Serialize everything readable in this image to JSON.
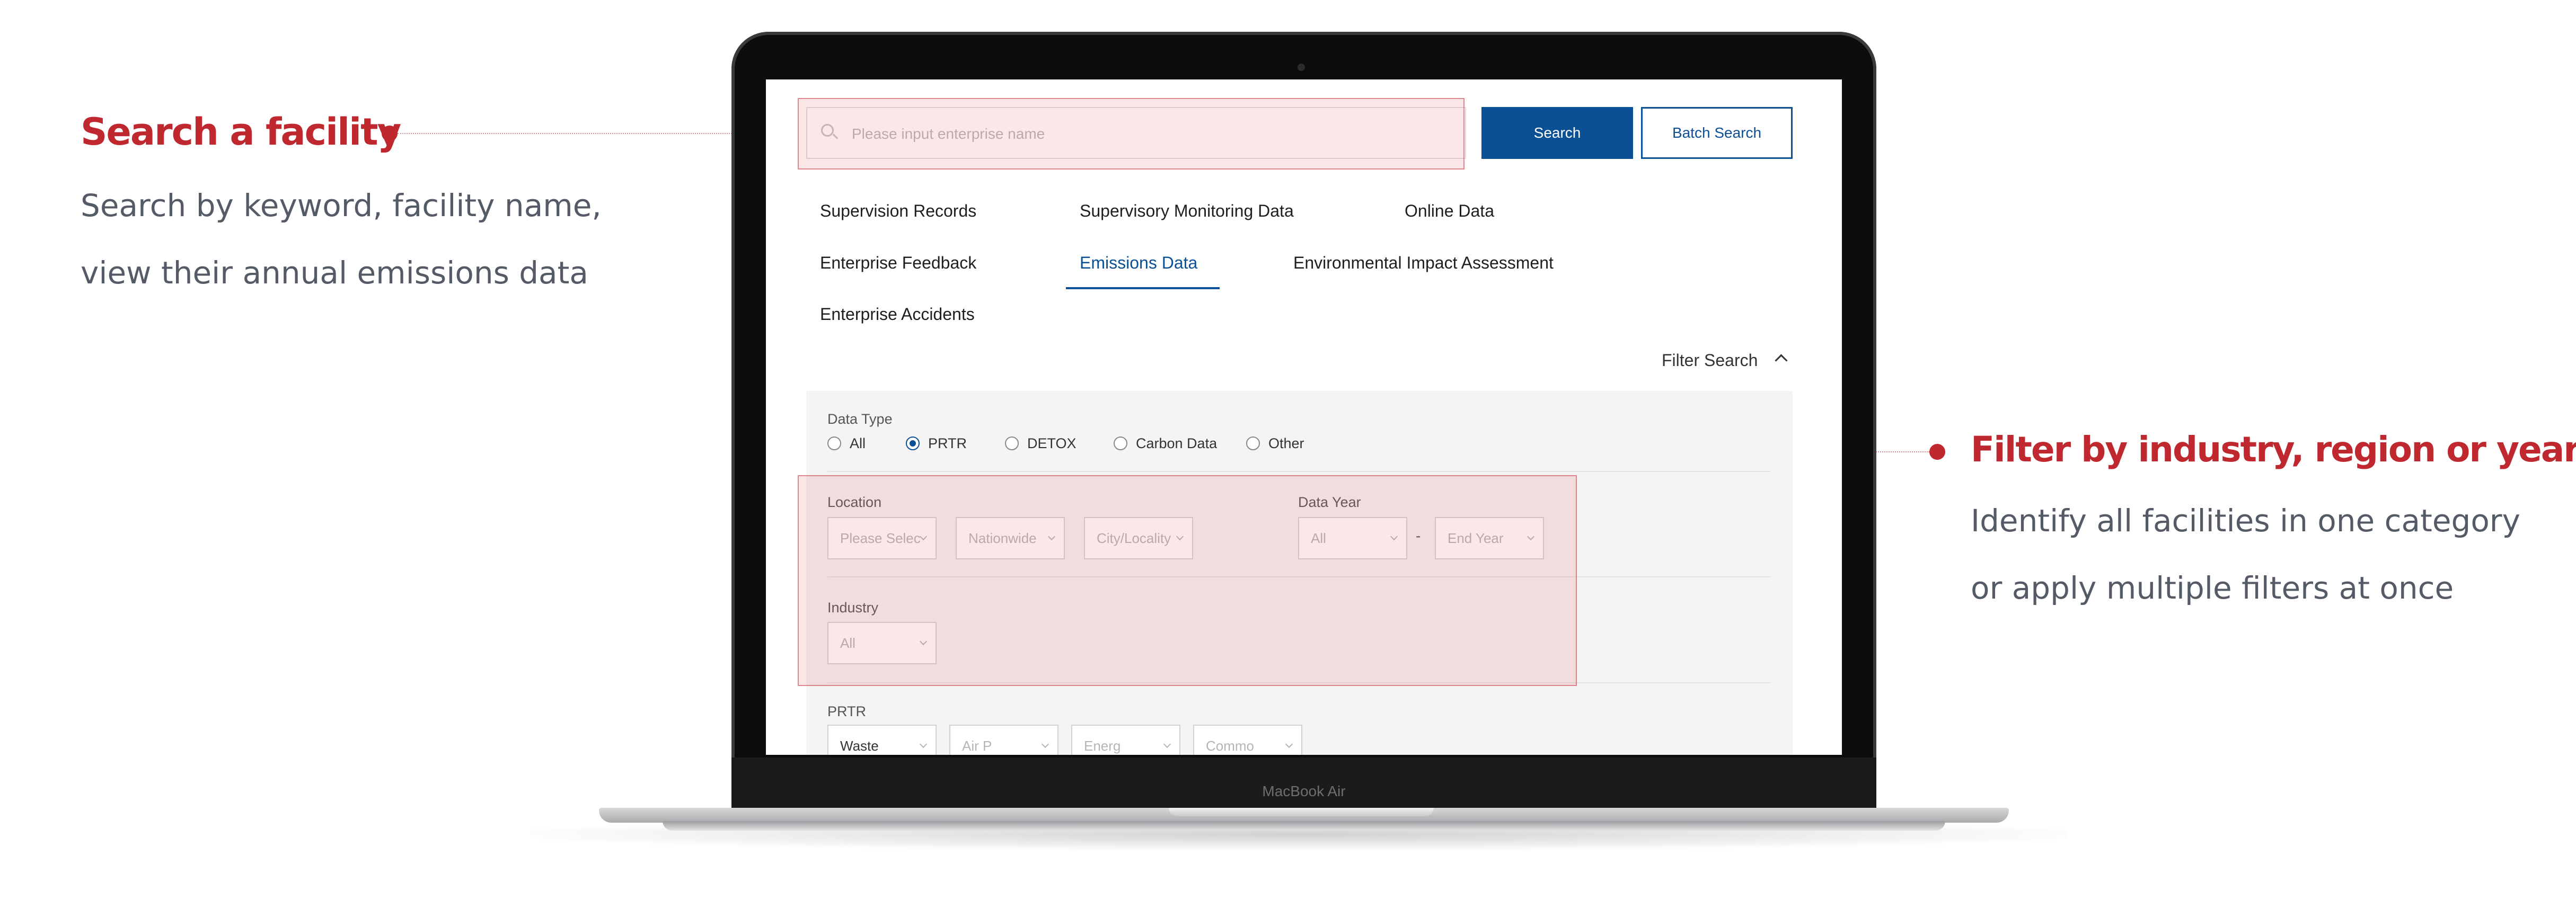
{
  "annotations": {
    "search": {
      "title": "Search a facility",
      "lines": [
        "Search by keyword, facility name,",
        "view their annual emissions data"
      ]
    },
    "filter": {
      "title": "Filter by industry,  region or year",
      "lines": [
        "Identify all facilities in one category",
        "or apply multiple filters at once"
      ]
    }
  },
  "device": {
    "brand": "MacBook Air"
  },
  "search": {
    "placeholder": "Please input enterprise name",
    "search_label": "Search",
    "batch_label": "Batch Search"
  },
  "tabs": [
    {
      "label": "Supervision Records"
    },
    {
      "label": "Supervisory Monitoring Data"
    },
    {
      "label": "Online Data"
    },
    {
      "label": "Enterprise Feedback"
    },
    {
      "label": "Emissions Data",
      "active": true
    },
    {
      "label": "Environmental Impact Assessment"
    },
    {
      "label": "Enterprise Accidents"
    }
  ],
  "filter_toggle": "Filter Search",
  "filters": {
    "data_type": {
      "label": "Data Type",
      "options": [
        "All",
        "PRTR",
        "DETOX",
        "Carbon Data",
        "Other"
      ],
      "selected": "PRTR"
    },
    "location": {
      "label": "Location",
      "selects": [
        "Please Selec",
        "Nationwide",
        "City/Locality"
      ]
    },
    "data_year": {
      "label": "Data Year",
      "start": "All",
      "separator": "-",
      "end": "End Year"
    },
    "industry": {
      "label": "Industry",
      "value": "All"
    },
    "prtr": {
      "label": "PRTR",
      "selects": [
        "Waste",
        "Air P",
        "Energ",
        "Commo"
      ]
    }
  },
  "colors": {
    "accent": "#c0282f",
    "primary": "#0b4f95",
    "annotation_text": "#555b66"
  }
}
